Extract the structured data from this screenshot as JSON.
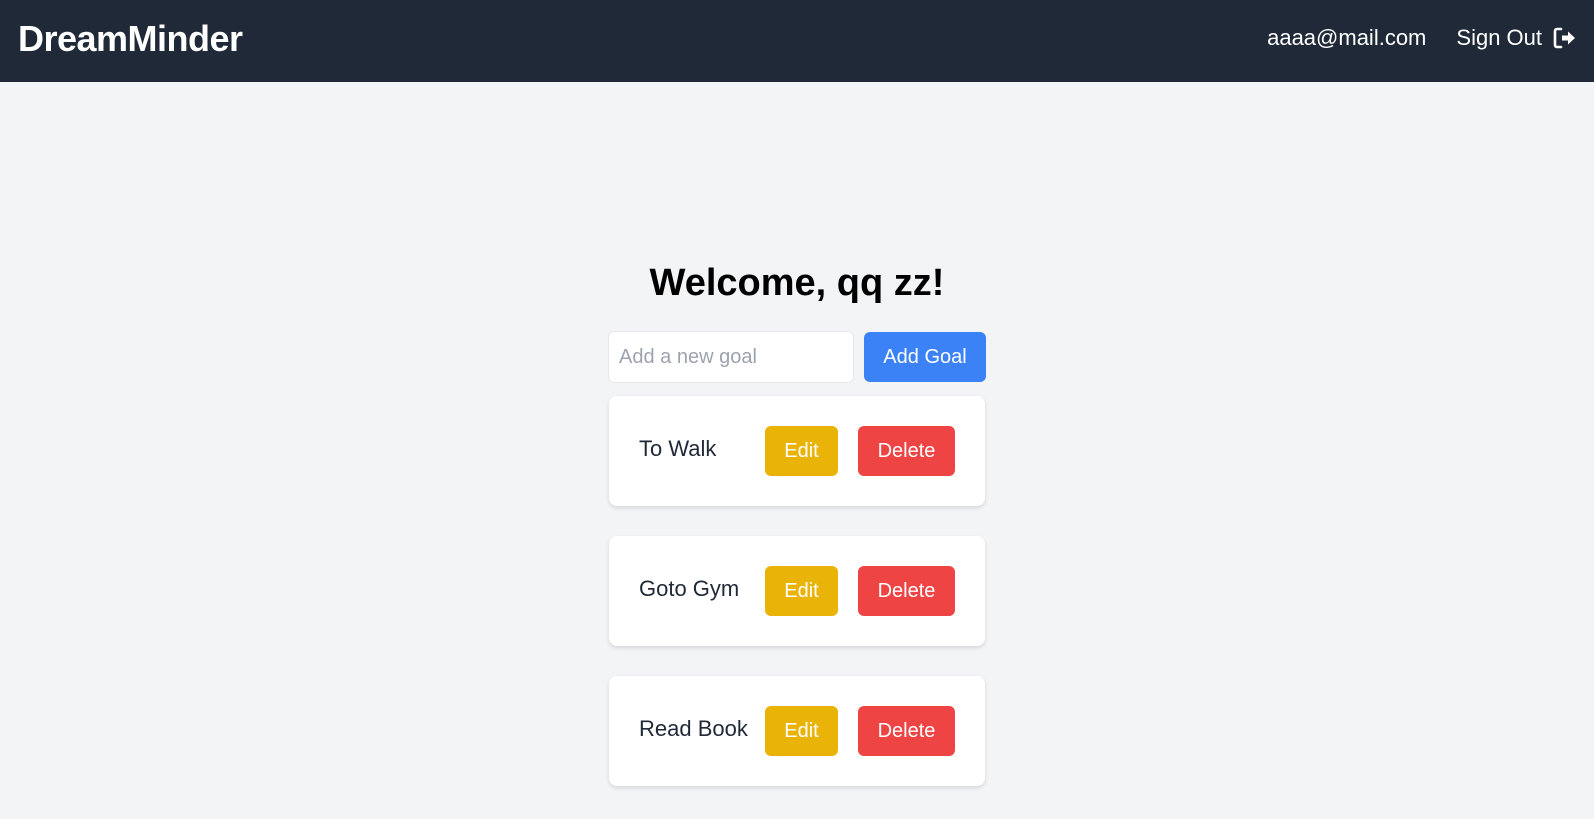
{
  "header": {
    "brand": "DreamMinder",
    "user_email": "aaaa@mail.com",
    "signout_label": "Sign Out",
    "signout_icon": "sign-out-icon"
  },
  "main": {
    "welcome": "Welcome, qq zz!",
    "add_form": {
      "input_value": "",
      "input_placeholder": "Add a new goal",
      "add_label": "Add Goal"
    },
    "goals": [
      {
        "text": "To Walk",
        "edit_label": "Edit",
        "delete_label": "Delete"
      },
      {
        "text": "Goto Gym",
        "edit_label": "Edit",
        "delete_label": "Delete"
      },
      {
        "text": "Read Book",
        "edit_label": "Edit",
        "delete_label": "Delete"
      }
    ]
  },
  "colors": {
    "navbar": "#1f2937",
    "background": "#f3f4f6",
    "primary": "#3b82f6",
    "edit": "#eab308",
    "delete": "#ef4444"
  }
}
